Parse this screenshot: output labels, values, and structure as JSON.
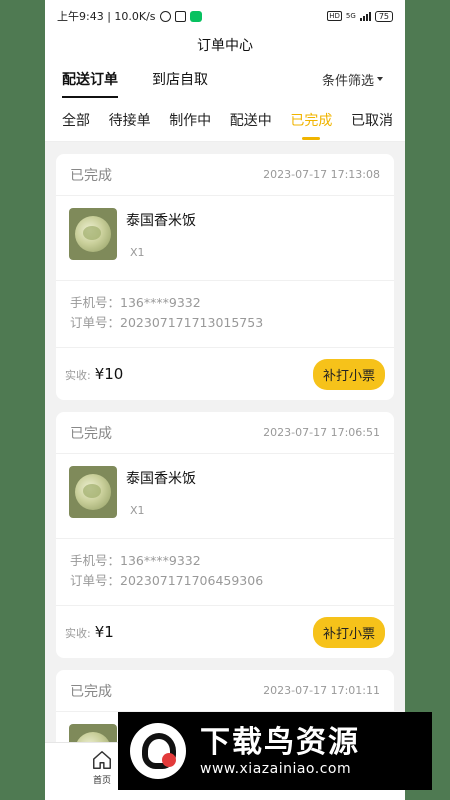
{
  "status_bar": {
    "time_speed": "上午9:43 | 10.0K/s",
    "network": "5G",
    "battery": "75",
    "hd": "HD"
  },
  "header": {
    "title": "订单中心"
  },
  "type_tabs": [
    {
      "label": "配送订单",
      "active": true
    },
    {
      "label": "到店自取",
      "active": false
    }
  ],
  "filter": {
    "label": "条件筛选"
  },
  "status_tabs": [
    {
      "label": "全部"
    },
    {
      "label": "待接单"
    },
    {
      "label": "制作中"
    },
    {
      "label": "配送中"
    },
    {
      "label": "已完成",
      "active": true
    },
    {
      "label": "已取消"
    }
  ],
  "orders": [
    {
      "status": "已完成",
      "time": "2023-07-17 17:13:08",
      "product": "泰国香米饭",
      "qty": "X1",
      "phone_label": "手机号：",
      "phone": "136****9332",
      "order_label": "订单号：",
      "order_no": "20230717171301575­3",
      "received_label": "实收:",
      "amount": "¥10",
      "reprint": "补打小票"
    },
    {
      "status": "已完成",
      "time": "2023-07-17 17:06:51",
      "product": "泰国香米饭",
      "qty": "X1",
      "phone_label": "手机号：",
      "phone": "136****9332",
      "order_label": "订单号：",
      "order_no": "202307171706459306",
      "received_label": "实收:",
      "amount": "¥1",
      "reprint": "补打小票"
    },
    {
      "status": "已完成",
      "time": "2023-07-17 17:01:11"
    }
  ],
  "bottom_nav": {
    "home": "首页"
  },
  "watermark": {
    "brand": "下载鸟资源",
    "url": "www.xiazainiao.com"
  },
  "colors": {
    "accent": "#f0b400",
    "button": "#f6c21a",
    "background": "#4f7a52"
  }
}
